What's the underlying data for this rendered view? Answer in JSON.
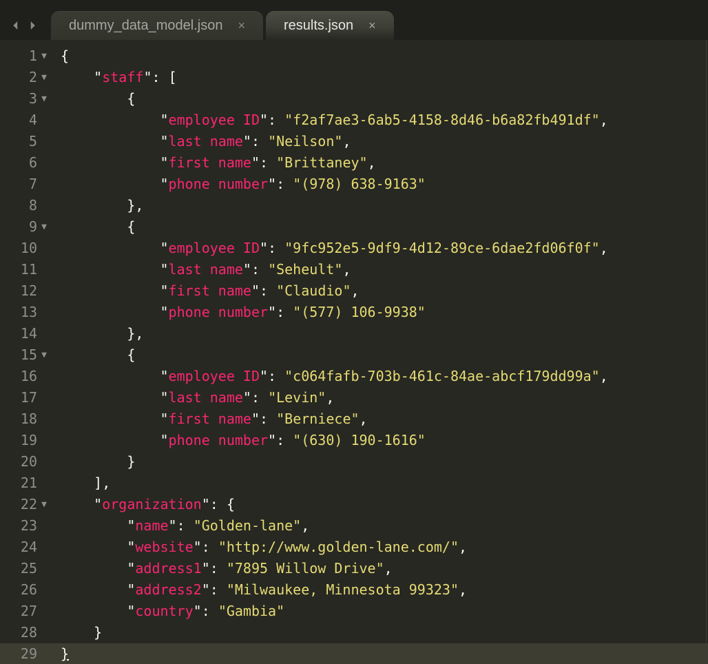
{
  "tabs": [
    {
      "label": "dummy_data_model.json",
      "active": false
    },
    {
      "label": "results.json",
      "active": true
    }
  ],
  "gutter": {
    "lines": [
      1,
      2,
      3,
      4,
      5,
      6,
      7,
      8,
      9,
      10,
      11,
      12,
      13,
      14,
      15,
      16,
      17,
      18,
      19,
      20,
      21,
      22,
      23,
      24,
      25,
      26,
      27,
      28,
      29
    ],
    "foldable": [
      1,
      2,
      3,
      9,
      15,
      22
    ],
    "current": 29
  },
  "indent": "    ",
  "code": {
    "l1": "{",
    "l2": {
      "indent": 1,
      "key": "staff",
      "after": ": ["
    },
    "l3": {
      "indent": 2,
      "text": "{"
    },
    "l4": {
      "indent": 3,
      "key": "employee ID",
      "sep": ": ",
      "val": "f2af7ae3-6ab5-4158-8d46-b6a82fb491df",
      "comma": ","
    },
    "l5": {
      "indent": 3,
      "key": "last name",
      "sep": ": ",
      "val": "Neilson",
      "comma": ","
    },
    "l6": {
      "indent": 3,
      "key": "first name",
      "sep": ": ",
      "val": "Brittaney",
      "comma": ","
    },
    "l7": {
      "indent": 3,
      "key": "phone number",
      "sep": ": ",
      "val": "(978) 638-9163"
    },
    "l8": {
      "indent": 2,
      "text": "},"
    },
    "l9": {
      "indent": 2,
      "text": "{"
    },
    "l10": {
      "indent": 3,
      "key": "employee ID",
      "sep": ": ",
      "val": "9fc952e5-9df9-4d12-89ce-6dae2fd06f0f",
      "comma": ","
    },
    "l11": {
      "indent": 3,
      "key": "last name",
      "sep": ": ",
      "val": "Seheult",
      "comma": ","
    },
    "l12": {
      "indent": 3,
      "key": "first name",
      "sep": ": ",
      "val": "Claudio",
      "comma": ","
    },
    "l13": {
      "indent": 3,
      "key": "phone number",
      "sep": ": ",
      "val": "(577) 106-9938"
    },
    "l14": {
      "indent": 2,
      "text": "},"
    },
    "l15": {
      "indent": 2,
      "text": "{"
    },
    "l16": {
      "indent": 3,
      "key": "employee ID",
      "sep": ": ",
      "val": "c064fafb-703b-461c-84ae-abcf179dd99a",
      "comma": ","
    },
    "l17": {
      "indent": 3,
      "key": "last name",
      "sep": ": ",
      "val": "Levin",
      "comma": ","
    },
    "l18": {
      "indent": 3,
      "key": "first name",
      "sep": ": ",
      "val": "Berniece",
      "comma": ","
    },
    "l19": {
      "indent": 3,
      "key": "phone number",
      "sep": ": ",
      "val": "(630) 190-1616"
    },
    "l20": {
      "indent": 2,
      "text": "}"
    },
    "l21": {
      "indent": 1,
      "text": "],"
    },
    "l22": {
      "indent": 1,
      "key": "organization",
      "after": ": {"
    },
    "l23": {
      "indent": 2,
      "key": "name",
      "sep": ": ",
      "val": "Golden-lane",
      "comma": ","
    },
    "l24": {
      "indent": 2,
      "key": "website",
      "sep": ": ",
      "val": "http://www.golden-lane.com/",
      "comma": ","
    },
    "l25": {
      "indent": 2,
      "key": "address1",
      "sep": ": ",
      "val": "7895 Willow Drive",
      "comma": ","
    },
    "l26": {
      "indent": 2,
      "key": "address2",
      "sep": ": ",
      "val": "Milwaukee, Minnesota 99323",
      "comma": ","
    },
    "l27": {
      "indent": 2,
      "key": "country",
      "sep": ": ",
      "val": "Gambia"
    },
    "l28": {
      "indent": 1,
      "text": "}"
    },
    "l29": "}"
  }
}
